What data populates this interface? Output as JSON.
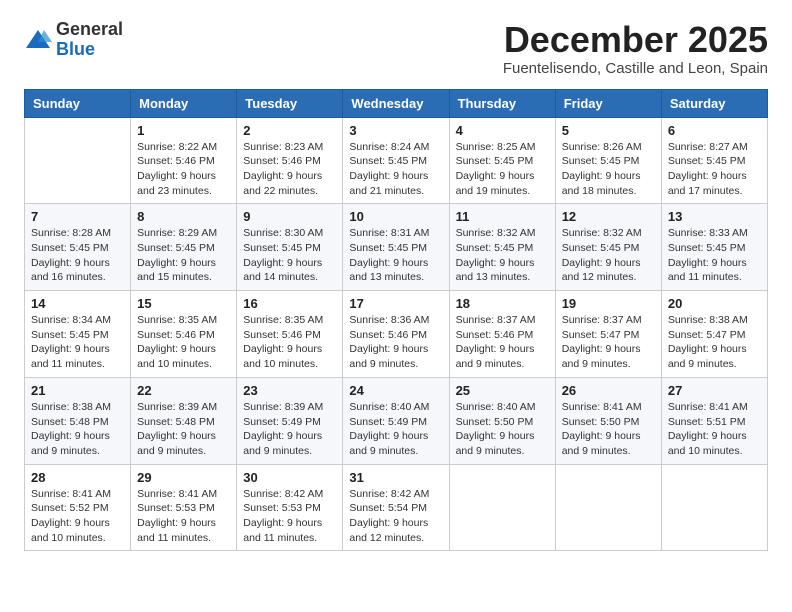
{
  "logo": {
    "general": "General",
    "blue": "Blue"
  },
  "header": {
    "month": "December 2025",
    "location": "Fuentelisendo, Castille and Leon, Spain"
  },
  "weekdays": [
    "Sunday",
    "Monday",
    "Tuesday",
    "Wednesday",
    "Thursday",
    "Friday",
    "Saturday"
  ],
  "weeks": [
    [
      {
        "day": null
      },
      {
        "day": "1",
        "sunrise": "8:22 AM",
        "sunset": "5:46 PM",
        "daylight": "9 hours and 23 minutes."
      },
      {
        "day": "2",
        "sunrise": "8:23 AM",
        "sunset": "5:46 PM",
        "daylight": "9 hours and 22 minutes."
      },
      {
        "day": "3",
        "sunrise": "8:24 AM",
        "sunset": "5:45 PM",
        "daylight": "9 hours and 21 minutes."
      },
      {
        "day": "4",
        "sunrise": "8:25 AM",
        "sunset": "5:45 PM",
        "daylight": "9 hours and 19 minutes."
      },
      {
        "day": "5",
        "sunrise": "8:26 AM",
        "sunset": "5:45 PM",
        "daylight": "9 hours and 18 minutes."
      },
      {
        "day": "6",
        "sunrise": "8:27 AM",
        "sunset": "5:45 PM",
        "daylight": "9 hours and 17 minutes."
      }
    ],
    [
      {
        "day": "7",
        "sunrise": "8:28 AM",
        "sunset": "5:45 PM",
        "daylight": "9 hours and 16 minutes."
      },
      {
        "day": "8",
        "sunrise": "8:29 AM",
        "sunset": "5:45 PM",
        "daylight": "9 hours and 15 minutes."
      },
      {
        "day": "9",
        "sunrise": "8:30 AM",
        "sunset": "5:45 PM",
        "daylight": "9 hours and 14 minutes."
      },
      {
        "day": "10",
        "sunrise": "8:31 AM",
        "sunset": "5:45 PM",
        "daylight": "9 hours and 13 minutes."
      },
      {
        "day": "11",
        "sunrise": "8:32 AM",
        "sunset": "5:45 PM",
        "daylight": "9 hours and 13 minutes."
      },
      {
        "day": "12",
        "sunrise": "8:32 AM",
        "sunset": "5:45 PM",
        "daylight": "9 hours and 12 minutes."
      },
      {
        "day": "13",
        "sunrise": "8:33 AM",
        "sunset": "5:45 PM",
        "daylight": "9 hours and 11 minutes."
      }
    ],
    [
      {
        "day": "14",
        "sunrise": "8:34 AM",
        "sunset": "5:45 PM",
        "daylight": "9 hours and 11 minutes."
      },
      {
        "day": "15",
        "sunrise": "8:35 AM",
        "sunset": "5:46 PM",
        "daylight": "9 hours and 10 minutes."
      },
      {
        "day": "16",
        "sunrise": "8:35 AM",
        "sunset": "5:46 PM",
        "daylight": "9 hours and 10 minutes."
      },
      {
        "day": "17",
        "sunrise": "8:36 AM",
        "sunset": "5:46 PM",
        "daylight": "9 hours and 9 minutes."
      },
      {
        "day": "18",
        "sunrise": "8:37 AM",
        "sunset": "5:46 PM",
        "daylight": "9 hours and 9 minutes."
      },
      {
        "day": "19",
        "sunrise": "8:37 AM",
        "sunset": "5:47 PM",
        "daylight": "9 hours and 9 minutes."
      },
      {
        "day": "20",
        "sunrise": "8:38 AM",
        "sunset": "5:47 PM",
        "daylight": "9 hours and 9 minutes."
      }
    ],
    [
      {
        "day": "21",
        "sunrise": "8:38 AM",
        "sunset": "5:48 PM",
        "daylight": "9 hours and 9 minutes."
      },
      {
        "day": "22",
        "sunrise": "8:39 AM",
        "sunset": "5:48 PM",
        "daylight": "9 hours and 9 minutes."
      },
      {
        "day": "23",
        "sunrise": "8:39 AM",
        "sunset": "5:49 PM",
        "daylight": "9 hours and 9 minutes."
      },
      {
        "day": "24",
        "sunrise": "8:40 AM",
        "sunset": "5:49 PM",
        "daylight": "9 hours and 9 minutes."
      },
      {
        "day": "25",
        "sunrise": "8:40 AM",
        "sunset": "5:50 PM",
        "daylight": "9 hours and 9 minutes."
      },
      {
        "day": "26",
        "sunrise": "8:41 AM",
        "sunset": "5:50 PM",
        "daylight": "9 hours and 9 minutes."
      },
      {
        "day": "27",
        "sunrise": "8:41 AM",
        "sunset": "5:51 PM",
        "daylight": "9 hours and 10 minutes."
      }
    ],
    [
      {
        "day": "28",
        "sunrise": "8:41 AM",
        "sunset": "5:52 PM",
        "daylight": "9 hours and 10 minutes."
      },
      {
        "day": "29",
        "sunrise": "8:41 AM",
        "sunset": "5:53 PM",
        "daylight": "9 hours and 11 minutes."
      },
      {
        "day": "30",
        "sunrise": "8:42 AM",
        "sunset": "5:53 PM",
        "daylight": "9 hours and 11 minutes."
      },
      {
        "day": "31",
        "sunrise": "8:42 AM",
        "sunset": "5:54 PM",
        "daylight": "9 hours and 12 minutes."
      },
      {
        "day": null
      },
      {
        "day": null
      },
      {
        "day": null
      }
    ]
  ]
}
